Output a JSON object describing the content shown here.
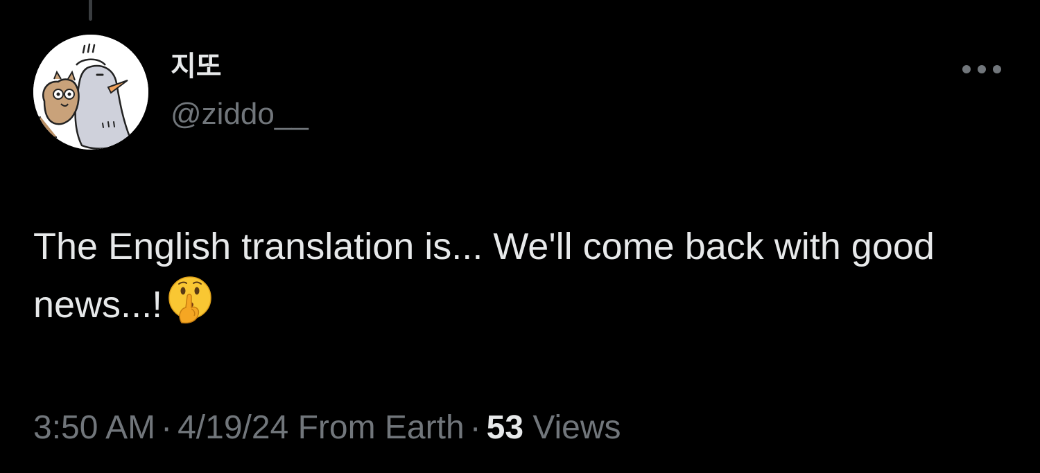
{
  "thread": {
    "has_parent_line": true
  },
  "author": {
    "display_name": "지또",
    "handle": "@ziddo__",
    "avatar_icon": "cartoon-pigeon-and-squirrel-avatar"
  },
  "actions": {
    "more_icon": "more-horizontal-icon"
  },
  "tweet": {
    "text": "The English translation is... We'll come back with good news...!",
    "emoji": "shushing-face-emoji"
  },
  "meta": {
    "time": "3:50 AM",
    "date": "4/19/24",
    "source": "From Earth",
    "separator": "·",
    "views_count": "53",
    "views_label": "Views"
  },
  "colors": {
    "background": "#000000",
    "primary_text": "#e7e9ea",
    "secondary_text": "#71767b"
  }
}
